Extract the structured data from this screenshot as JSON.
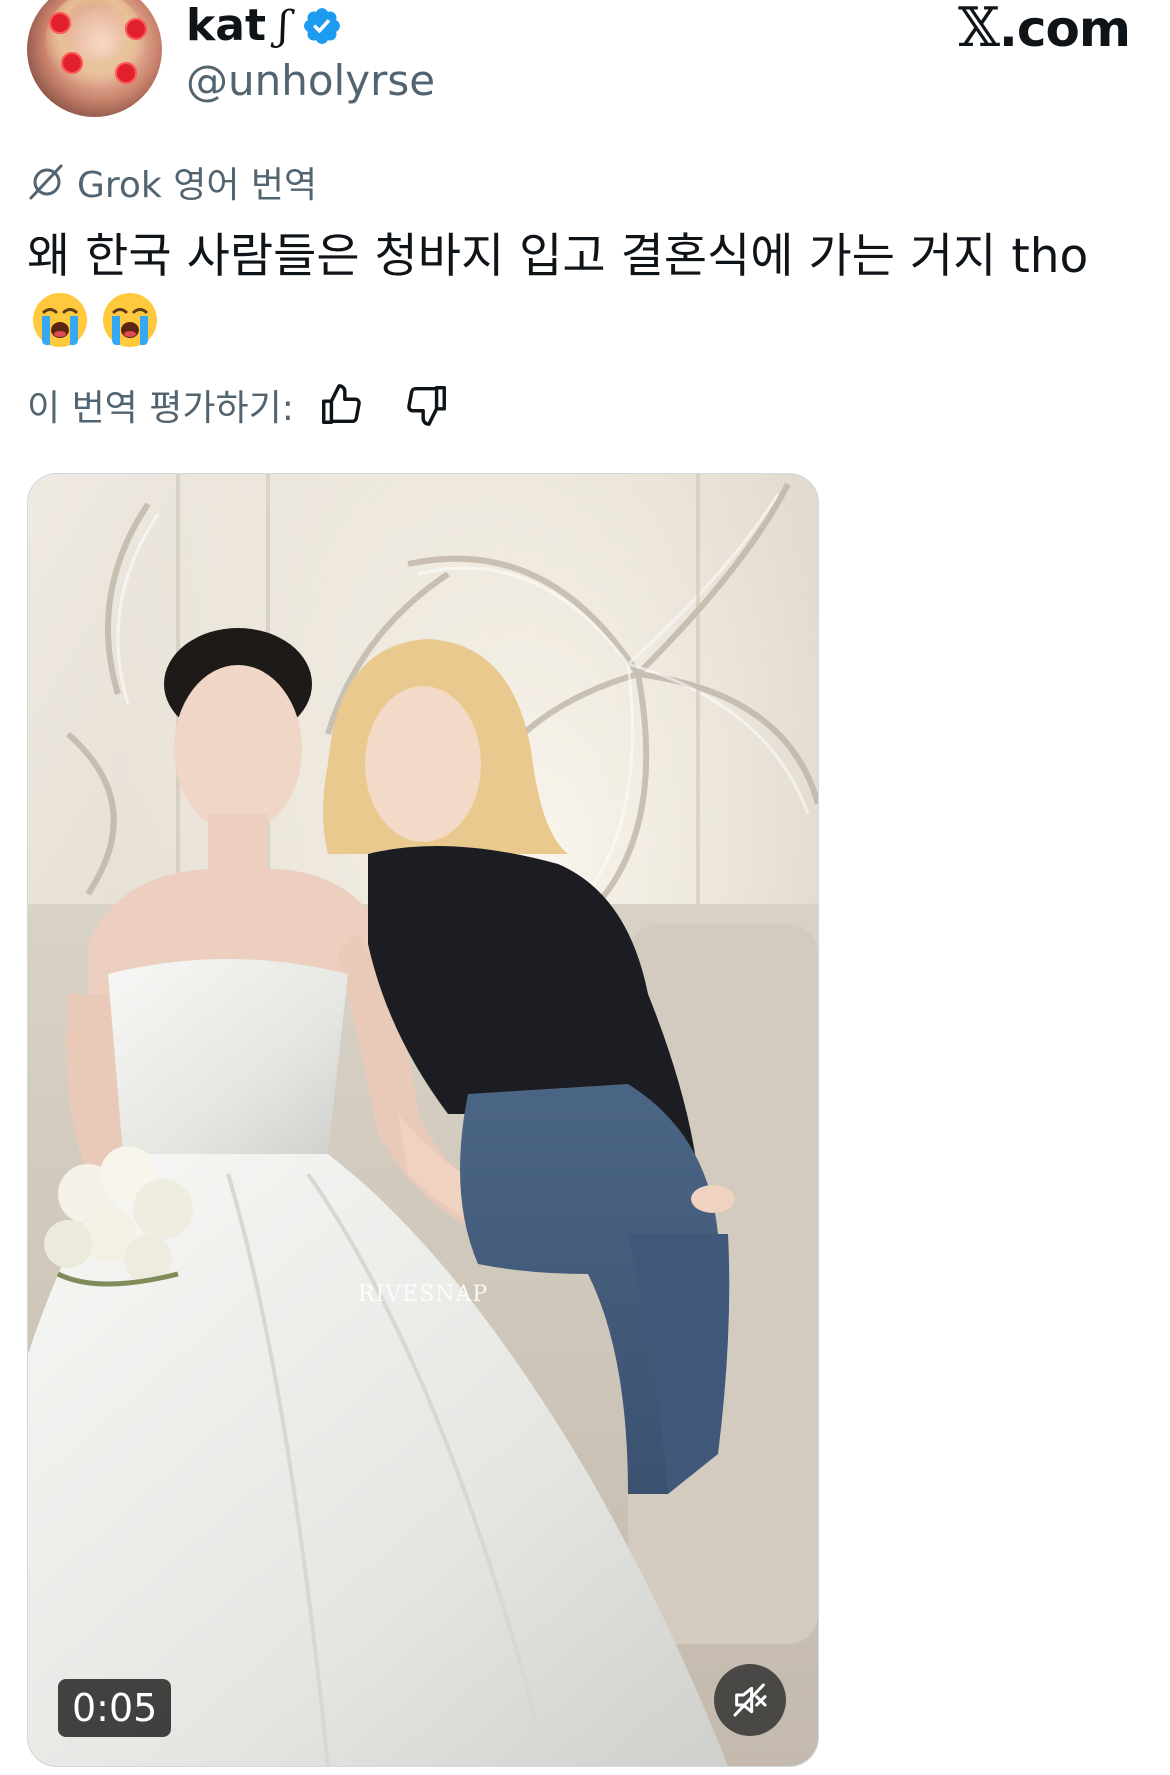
{
  "header": {
    "display_name": "kat",
    "name_emoji": "ʃ",
    "handle": "@unholyrse",
    "brand_prefix": "𝕏",
    "brand_suffix": ".com",
    "verified_color": "#1d9bf0"
  },
  "translation": {
    "label": "Grok 영어 번역",
    "tweet_text": "왜 한국 사람들은 청바지 입고 결혼식에 가는 거지 tho",
    "emojis": [
      "loudly-crying-face",
      "loudly-crying-face"
    ],
    "rate_label": "이 번역 평가하기:",
    "icons": {
      "grok": "grok-icon",
      "thumbs_up": "thumbs-up-icon",
      "thumbs_down": "thumbs-down-icon"
    }
  },
  "media": {
    "watermark": "RIVESNAP",
    "duration": "0:05",
    "muted": true,
    "icons": {
      "mute": "speaker-muted-icon"
    }
  },
  "colors": {
    "text_primary": "#0f1419",
    "text_secondary": "#536471",
    "accent": "#1d9bf0"
  }
}
